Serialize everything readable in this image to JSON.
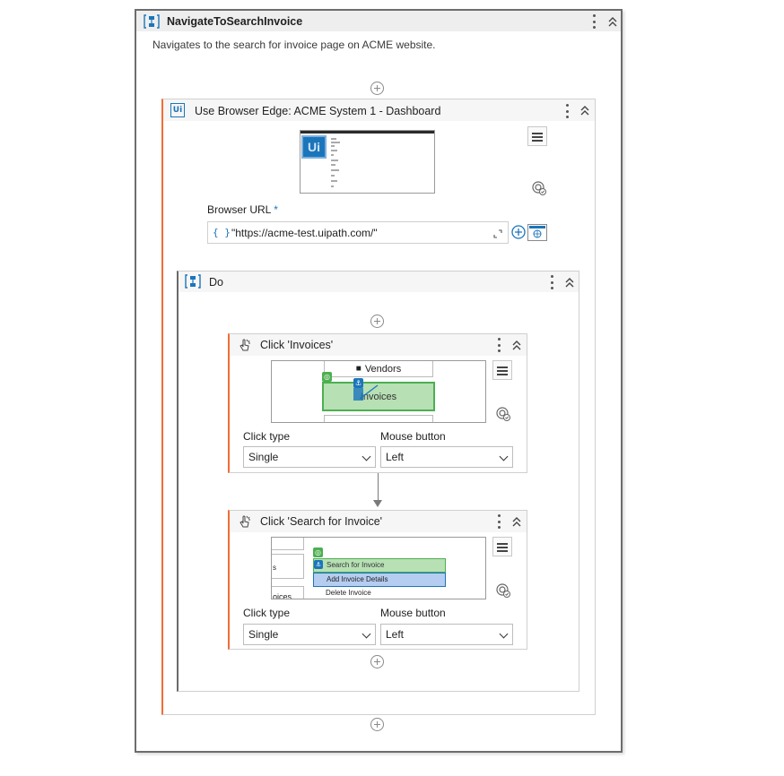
{
  "sequence": {
    "title": "NavigateToSearchInvoice",
    "description": "Navigates to the search for invoice page on ACME website."
  },
  "browser": {
    "title": "Use Browser Edge: ACME System 1 - Dashboard",
    "icon_text": "Ui",
    "url_label": "Browser URL",
    "url_required_mark": "*",
    "url_expr_icon": "{ }",
    "url_value": "\"https://acme-test.uipath.com/\""
  },
  "do": {
    "title": "Do"
  },
  "click1": {
    "title": "Click 'Invoices'",
    "thumb_top": "Vendors",
    "thumb_main": "Invoices",
    "click_type_label": "Click type",
    "click_type_value": "Single",
    "mouse_button_label": "Mouse button",
    "mouse_button_value": "Left"
  },
  "click2": {
    "title": "Click 'Search for Invoice'",
    "thumb_item1": "Search for Invoice",
    "thumb_item2": "Add Invoice Details",
    "thumb_item3": "Delete Invoice",
    "thumb_left_text1": "s",
    "thumb_left_text2": "oices",
    "click_type_label": "Click type",
    "click_type_value": "Single",
    "mouse_button_label": "Mouse button",
    "mouse_button_value": "Left"
  },
  "icons": {
    "sequence": "sequence-icon",
    "kebab": "more-vertical-icon",
    "collapse": "double-chevron-up-icon",
    "add": "plus-circle-icon",
    "menu": "hamburger-menu-icon",
    "target": "target-icon",
    "expand": "expand-icon",
    "browser_select": "browser-window-icon",
    "click": "click-hand-icon"
  },
  "colors": {
    "accent_orange": "#f26d35",
    "uipath_blue": "#1b75bb",
    "target_green": "#5cb85c"
  }
}
